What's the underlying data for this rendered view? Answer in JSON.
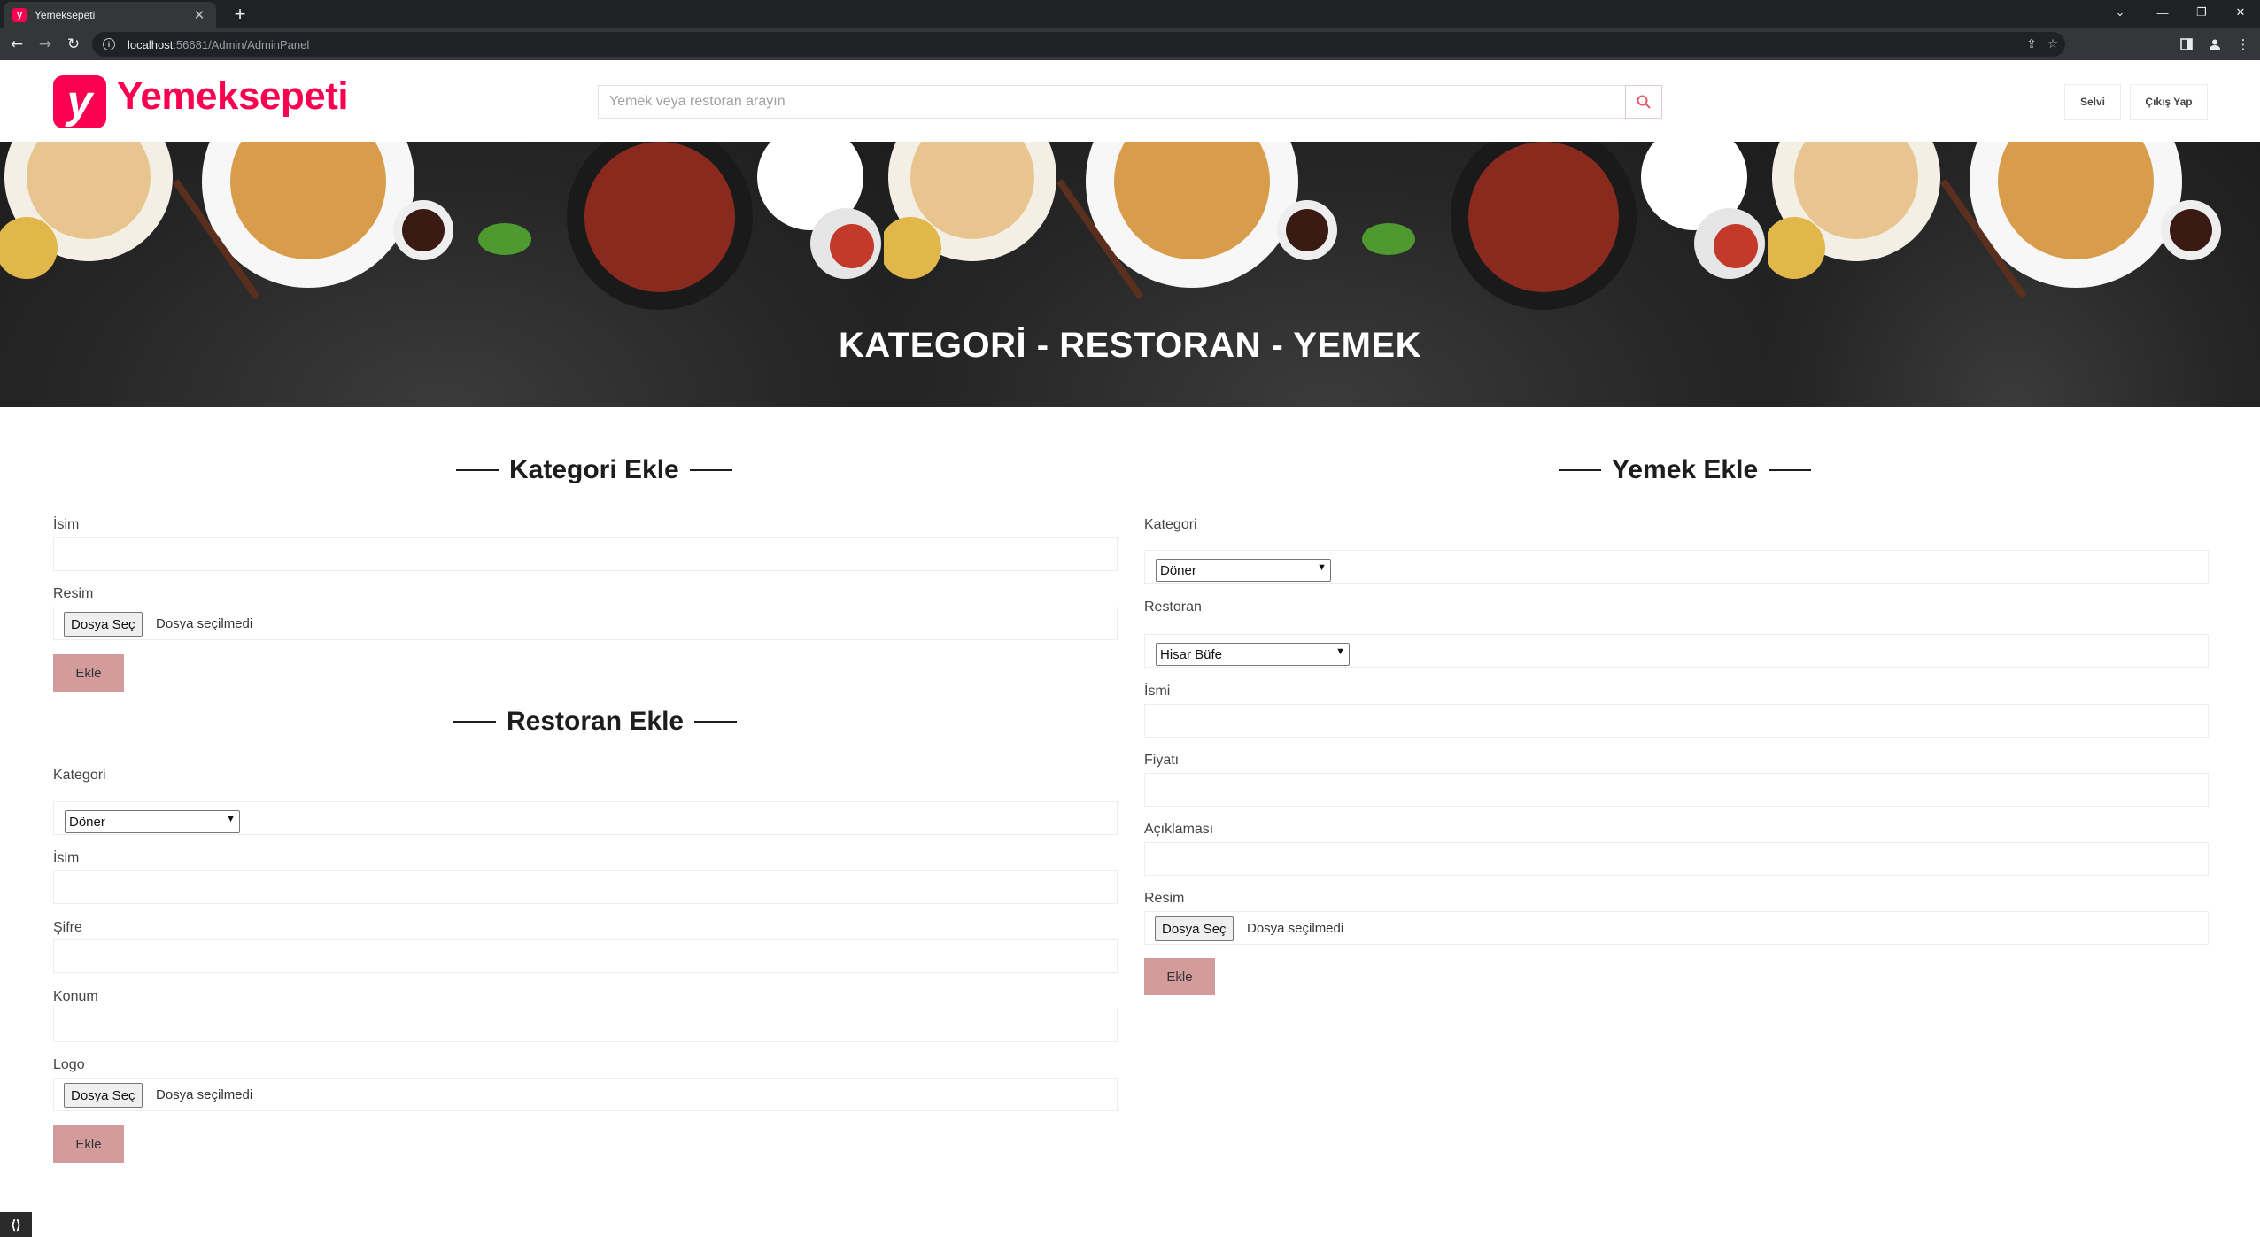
{
  "browser": {
    "tab_title": "Yemeksepeti",
    "favicon_letter": "y",
    "new_tab": "+",
    "url_host": "localhost",
    "url_rest": ":56681/Admin/AdminPanel",
    "icons": [
      "back-icon",
      "forward-icon",
      "reload-icon",
      "info-icon",
      "share-icon",
      "star-icon",
      "sidepanel-icon",
      "profile-icon",
      "menu-icon",
      "minimize-icon",
      "restore-icon",
      "close-icon",
      "tab-list-icon"
    ]
  },
  "header": {
    "logo_letter": "y",
    "brand": "Yemeksepeti",
    "search_placeholder": "Yemek veya restoran arayın",
    "user_label": "Selvi",
    "logout_label": "Çıkış Yap",
    "accent_color": "#fa0050"
  },
  "hero": {
    "title": "KATEGORİ - RESTORAN - YEMEK"
  },
  "kategori_form": {
    "title": "Kategori Ekle",
    "name_label": "İsim",
    "image_label": "Resim",
    "file_button": "Dosya Seç",
    "file_status": "Dosya seçilmedi",
    "submit": "Ekle"
  },
  "restoran_form": {
    "title": "Restoran Ekle",
    "category_label": "Kategori",
    "category_value": "Döner",
    "name_label": "İsim",
    "password_label": "Şifre",
    "location_label": "Konum",
    "logo_label": "Logo",
    "file_button": "Dosya Seç",
    "file_status": "Dosya seçilmedi",
    "submit": "Ekle"
  },
  "yemek_form": {
    "title": "Yemek Ekle",
    "category_label": "Kategori",
    "category_value": "Döner",
    "restaurant_label": "Restoran",
    "restaurant_value": "Hisar Büfe",
    "name_label": "İsmi",
    "price_label": "Fiyatı",
    "description_label": "Açıklaması",
    "image_label": "Resim",
    "file_button": "Dosya Seç",
    "file_status": "Dosya seçilmedi",
    "submit": "Ekle"
  },
  "colors": {
    "button_bg": "#d39b9b",
    "brand": "#fa0050"
  }
}
